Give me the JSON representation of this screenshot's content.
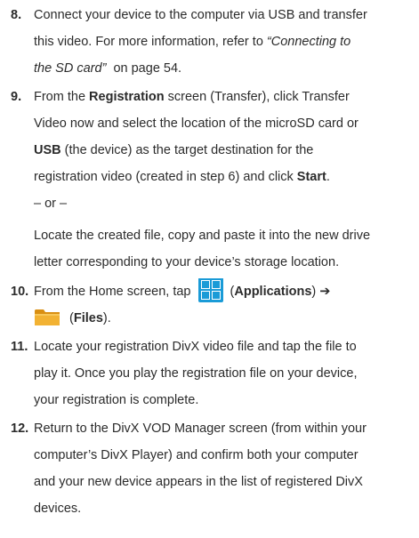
{
  "steps": [
    {
      "number": "8.",
      "lines": [
        {
          "a": "Connect your device to the computer via USB and transfer"
        },
        {
          "a": "this video. For more information, refer to ",
          "link": "“Connecting to"
        },
        {
          "link": "the SD card”",
          "b": "  on page 54."
        }
      ]
    },
    {
      "number": "9.",
      "lines": [
        {
          "a": "From the ",
          "bold": "Registration",
          "b": " screen (Transfer), click Transfer"
        },
        {
          "a": "Video now and select the location of the microSD card or"
        },
        {
          "bold": "USB",
          "b": " (the device) as the target destination for the"
        },
        {
          "a": "registration video (created in step 6) and click ",
          "bold": "Start",
          "b": "."
        },
        {
          "a": "– or –"
        },
        {
          "a": "Locate the created file, copy and paste it into the new drive"
        },
        {
          "a": "letter corresponding to your device’s storage location."
        }
      ]
    },
    {
      "number": "10.",
      "line1": {
        "a": "From the Home screen, tap ",
        "b": " (",
        "bold": "Applications",
        "c": ") ➔"
      },
      "line2": {
        "a": "(",
        "bold": "Files",
        "c": ")."
      },
      "apps_icon": "applications-grid-icon",
      "files_icon": "folder-icon",
      "colors": {
        "apps_bg": "#1a9bd7",
        "apps_tile": "#ffffff",
        "folder": "#f2b233",
        "folder_dark": "#d98f12"
      }
    },
    {
      "number": "11.",
      "lines": [
        {
          "a": "Locate your registration DivX video file and tap the file to"
        },
        {
          "a": "play it. Once you play the registration file on your device,"
        },
        {
          "a": "your registration is complete."
        }
      ]
    },
    {
      "number": "12.",
      "lines": [
        {
          "a": "Return to the DivX VOD Manager screen (from within your"
        },
        {
          "a": "computer’s DivX Player) and confirm both your computer"
        },
        {
          "a": "and your new device appears in the list of registered DivX"
        },
        {
          "a": "devices."
        }
      ]
    }
  ]
}
